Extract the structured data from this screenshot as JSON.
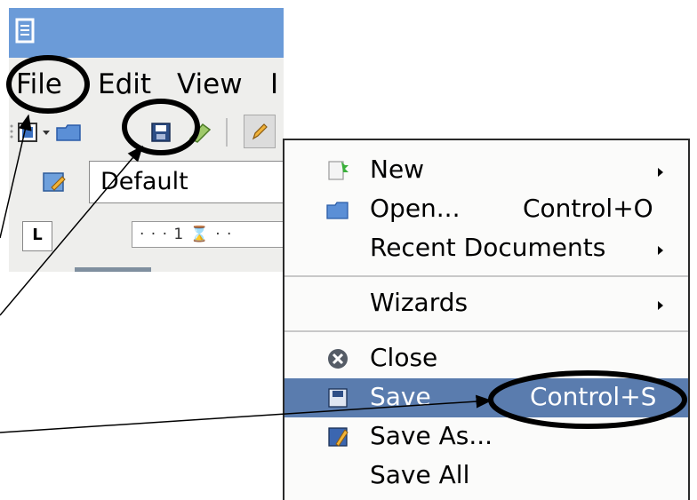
{
  "window": {
    "menubar": [
      {
        "id": "file",
        "label": "File"
      },
      {
        "id": "edit",
        "label": "Edit"
      },
      {
        "id": "view",
        "label": "View"
      },
      {
        "id": "insert",
        "label": "I"
      }
    ],
    "toolbar_icons": [
      "new-document-icon",
      "dropdown-arrow-icon",
      "open-folder-icon",
      "save-disk-icon",
      "export-icon",
      "edit-pencil-icon"
    ],
    "paragraph_style": "Default",
    "ruler_text": "· · · 1 ⌛ ·  ·"
  },
  "file_menu": {
    "items": [
      {
        "label": "New",
        "shortcut": "",
        "submenu": true,
        "icon": "new-document-icon"
      },
      {
        "label": "Open...",
        "shortcut": "Control+O",
        "submenu": false,
        "icon": "open-folder-icon"
      },
      {
        "label": "Recent Documents",
        "shortcut": "",
        "submenu": true,
        "icon": ""
      },
      {
        "label": "Wizards",
        "shortcut": "",
        "submenu": true,
        "icon": ""
      },
      {
        "label": "Close",
        "shortcut": "",
        "submenu": false,
        "icon": "close-circle-icon"
      },
      {
        "label": "Save",
        "shortcut": "Control+S",
        "submenu": false,
        "icon": "save-disk-icon",
        "highlighted": true
      },
      {
        "label": "Save As...",
        "shortcut": "",
        "submenu": false,
        "icon": "save-as-icon"
      },
      {
        "label": "Save All",
        "shortcut": "",
        "submenu": false,
        "icon": ""
      }
    ]
  },
  "colors": {
    "titlebar": "#6b9bd8",
    "highlight": "#5a7cae",
    "menu_bg": "#fbfbfa",
    "annotation": "#000000"
  }
}
